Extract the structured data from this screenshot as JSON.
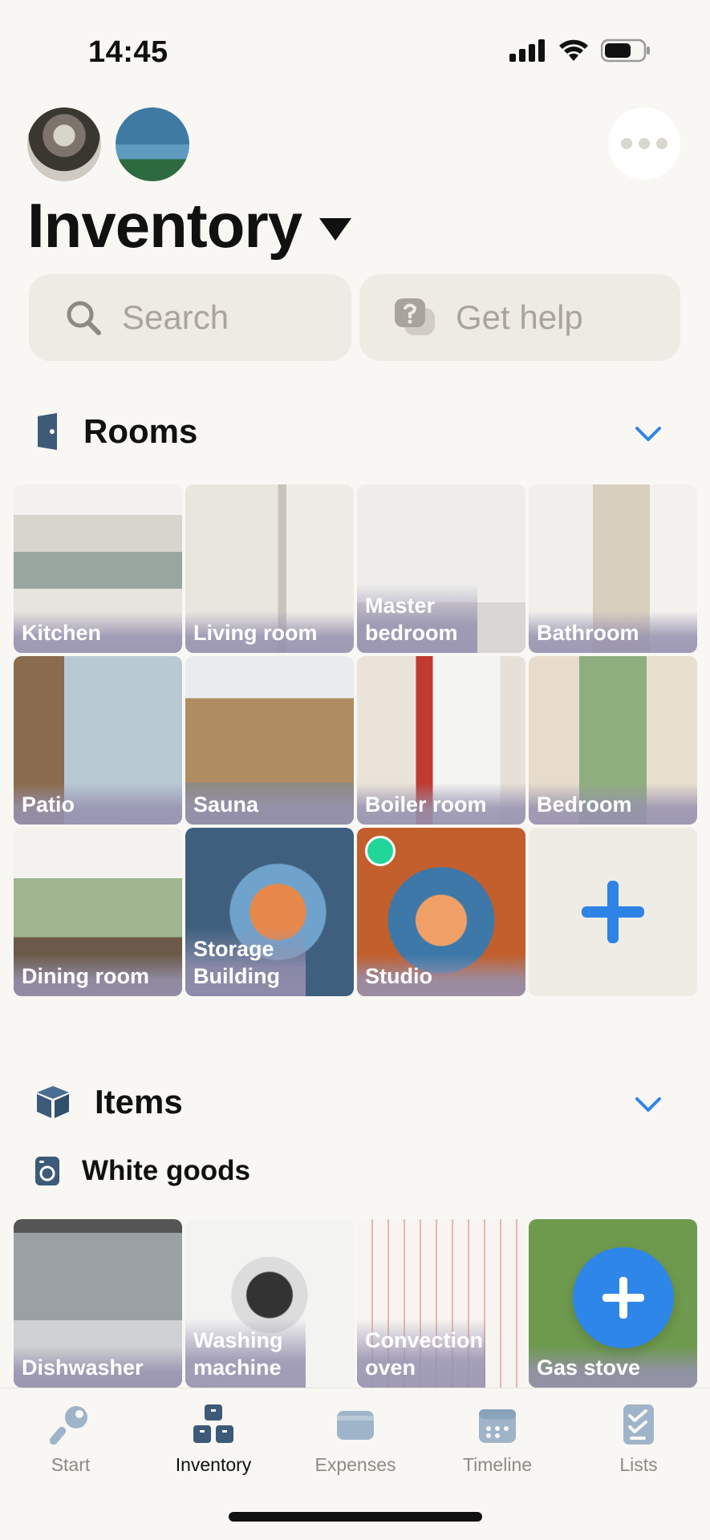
{
  "status_bar": {
    "time": "14:45"
  },
  "header": {
    "title": "Inventory"
  },
  "search": {
    "placeholder": "Search"
  },
  "help": {
    "label": "Get help"
  },
  "rooms": {
    "title": "Rooms",
    "items": [
      {
        "label": "Kitchen"
      },
      {
        "label": "Living room"
      },
      {
        "label": "Master bedroom"
      },
      {
        "label": "Bathroom"
      },
      {
        "label": "Patio"
      },
      {
        "label": "Sauna"
      },
      {
        "label": "Boiler room"
      },
      {
        "label": "Bedroom"
      },
      {
        "label": "Dining room"
      },
      {
        "label": "Storage Building"
      },
      {
        "label": "Studio"
      }
    ]
  },
  "items_section": {
    "title": "Items",
    "category": "White goods",
    "items": [
      {
        "label": "Dishwasher"
      },
      {
        "label": "Washing machine"
      },
      {
        "label": "Convection oven"
      },
      {
        "label": "Gas stove"
      }
    ]
  },
  "tabs": [
    {
      "label": "Start",
      "icon": "wrench-icon"
    },
    {
      "label": "Inventory",
      "icon": "boxes-icon",
      "active": true
    },
    {
      "label": "Expenses",
      "icon": "wallet-icon"
    },
    {
      "label": "Timeline",
      "icon": "calendar-icon"
    },
    {
      "label": "Lists",
      "icon": "checklist-icon"
    }
  ],
  "colors": {
    "accent": "#2e86e8",
    "background": "#f8f7f4",
    "studio_indicator": "#22d69a"
  }
}
